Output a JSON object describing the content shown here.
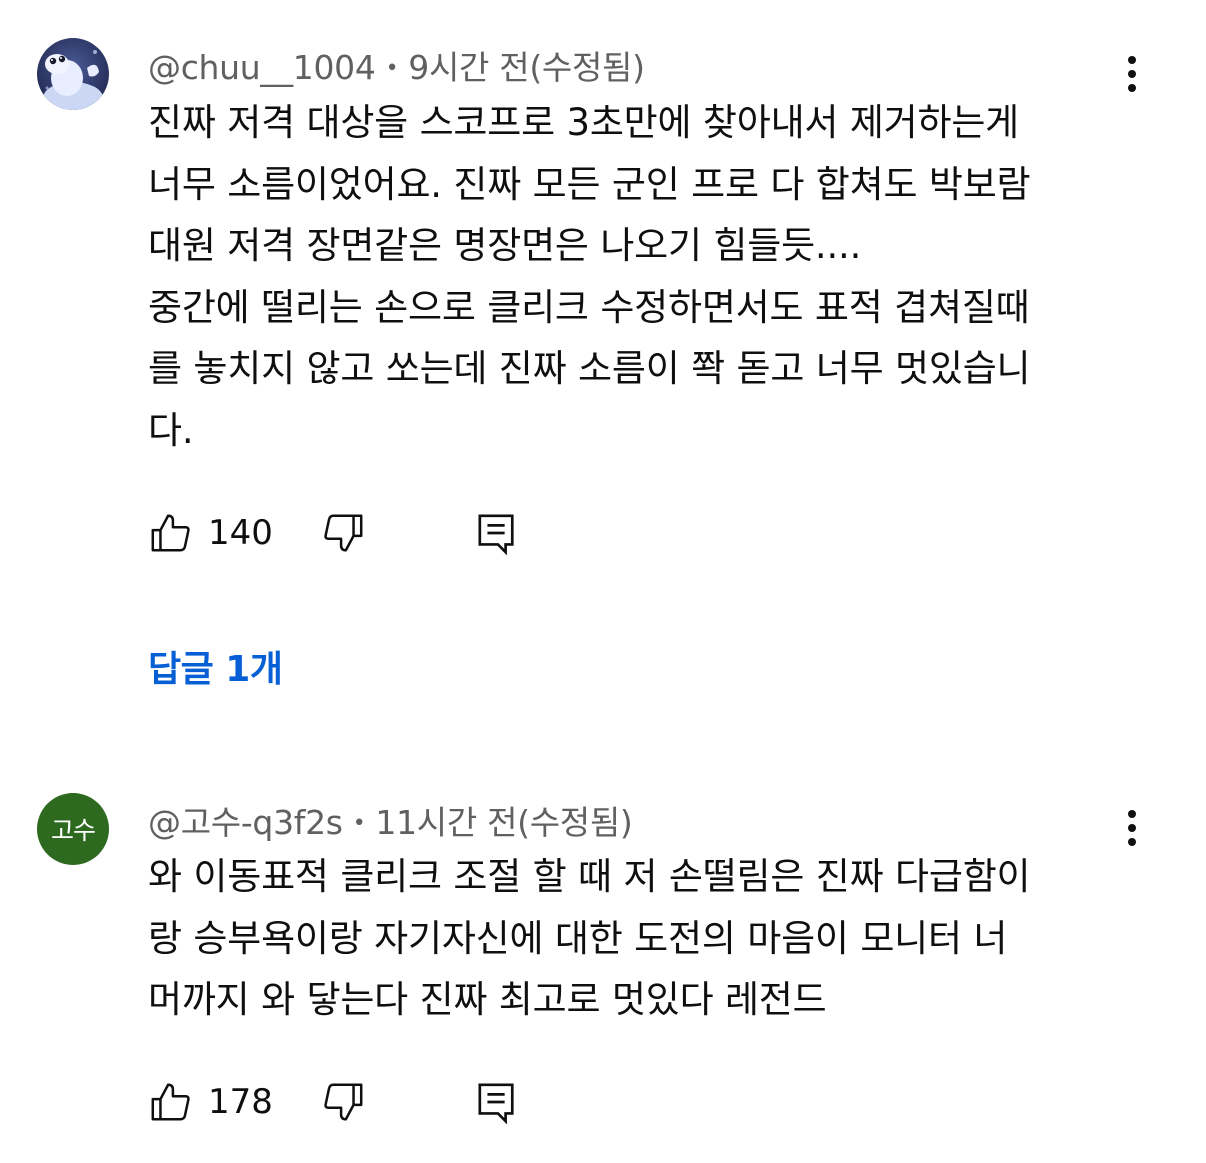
{
  "comments": [
    {
      "author": "@chuu__1004",
      "separator": "•",
      "time": "9시간 전(수정됨)",
      "text": "진짜 저격 대상을 스코프로 3초만에 찾아내서 제거하는게\n너무 소름이었어요. 진짜 모든 군인 프로 다 합쳐도 박보람\n대원 저격 장면같은 명장면은 나오기 힘들듯....\n중간에 떨리는 손으로 클리크 수정하면서도 표적 겹쳐질때\n를 놓치지 않고 쏘는데 진짜 소름이 쫙 돋고 너무 멋있습니\n다.",
      "likes": "140",
      "replies_label": "답글 1개"
    },
    {
      "author": "@고수-q3f2s",
      "separator": "•",
      "time": "11시간 전(수정됨)",
      "avatar_text": "고수",
      "avatar_color": "#2d6a1f",
      "text": "와 이동표적 클리크 조절 할 때 저 손떨림은 진짜 다급함이\n랑 승부욕이랑 자기자신에 대한 도전의 마음이 모니터 너\n머까지 와 닿는다 진짜 최고로 멋있다 레전드",
      "likes": "178"
    }
  ],
  "colors": {
    "link": "#065fd4",
    "meta": "#606060",
    "text": "#0f0f0f"
  },
  "icons": [
    "thumbs-up-icon",
    "thumbs-down-icon",
    "reply-comment-icon",
    "more-vert-icon"
  ]
}
